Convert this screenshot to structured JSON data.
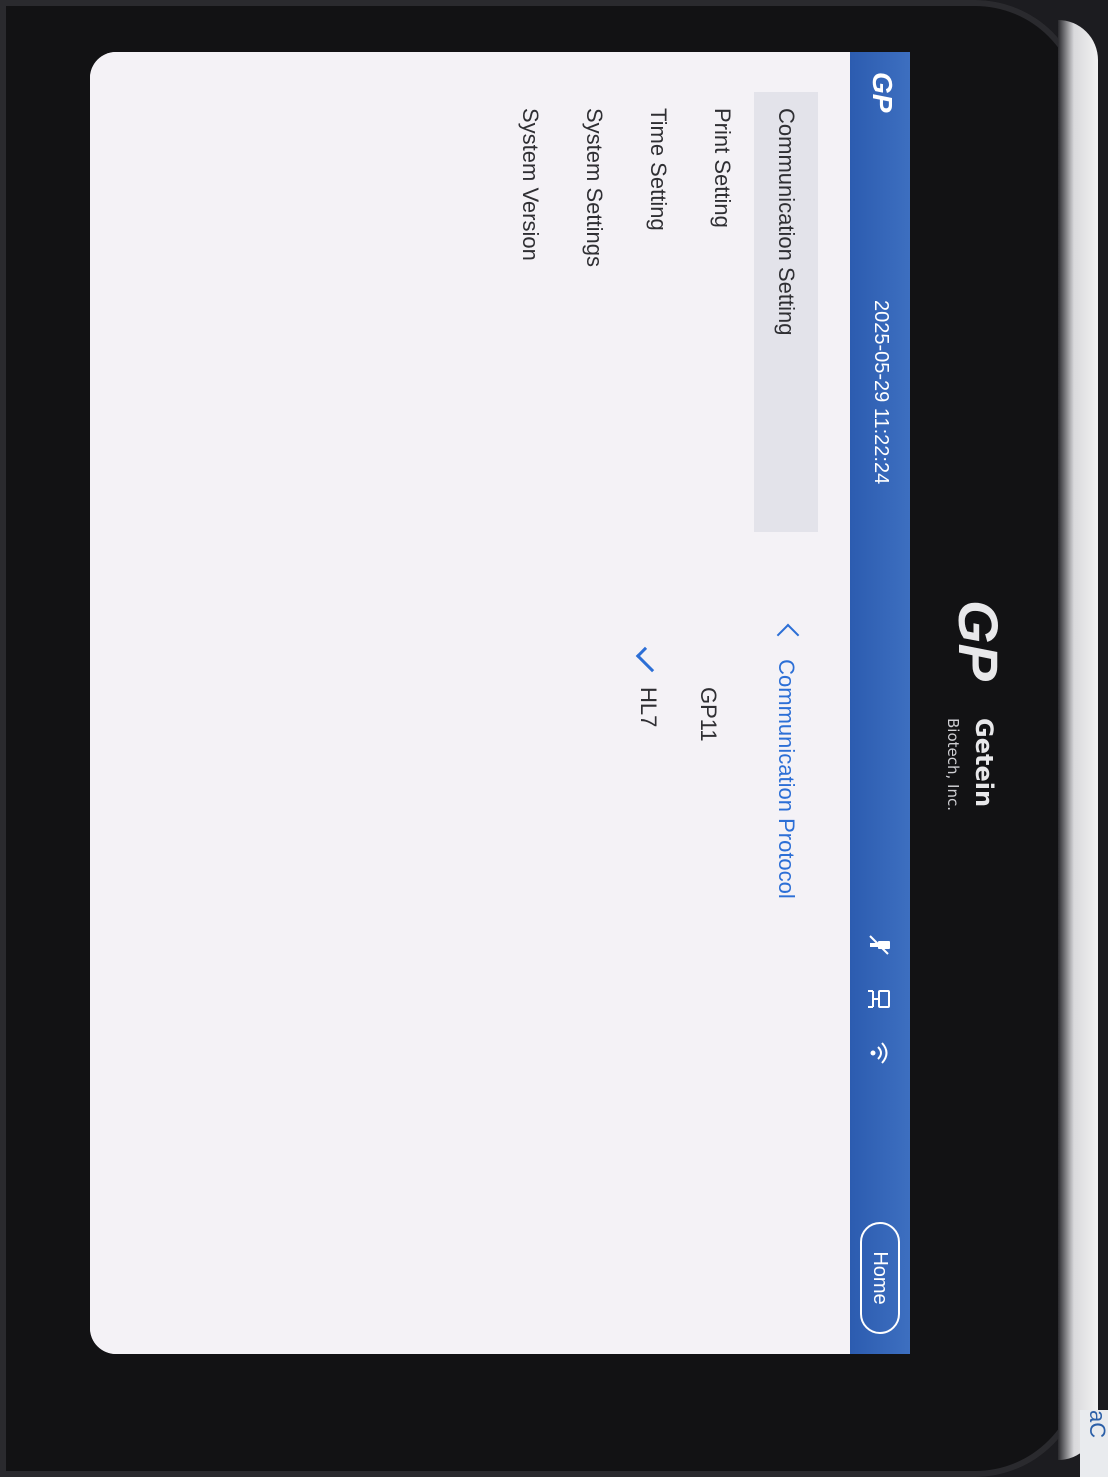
{
  "device": {
    "brand_logo": "GP",
    "brand_name": "Getein",
    "brand_sub": "Biotech, Inc.",
    "side_label": "aC"
  },
  "header": {
    "logo": "GP",
    "datetime": "2025-05-29 11:22:24",
    "icons": [
      "usb-icon",
      "network-icon",
      "wifi-icon"
    ],
    "home_label": "Home"
  },
  "sidebar": {
    "items": [
      {
        "label": "Communication Setting",
        "active": true
      },
      {
        "label": "Print Setting",
        "active": false
      },
      {
        "label": "Time Setting",
        "active": false
      },
      {
        "label": "System Settings",
        "active": false
      },
      {
        "label": "System Version",
        "active": false
      }
    ]
  },
  "detail": {
    "title": "Communication Protocol",
    "options": [
      {
        "label": "GP11",
        "selected": false
      },
      {
        "label": "HL7",
        "selected": true
      }
    ]
  },
  "colors": {
    "header": "#2c5cb0",
    "accent": "#2c6fd6",
    "active_item": "#e3e3ea"
  }
}
